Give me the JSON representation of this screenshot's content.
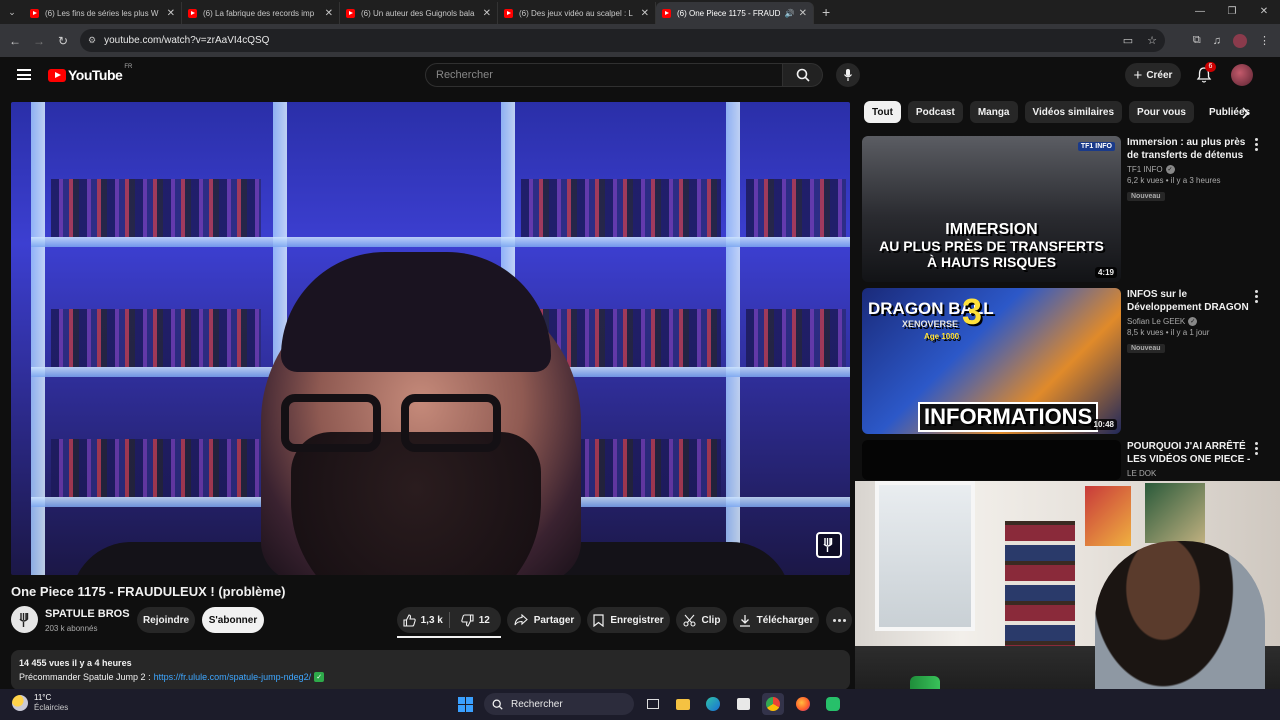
{
  "browser": {
    "tabs": [
      {
        "title": "(6) Les fins de séries les plus W"
      },
      {
        "title": "(6) La fabrique des records imp"
      },
      {
        "title": "(6) Un auteur des Guignols bala"
      },
      {
        "title": "(6) Des jeux vidéo au scalpel : L"
      },
      {
        "title": "(6) One Piece 1175 - FRAUD",
        "active": true
      }
    ],
    "url": "youtube.com/watch?v=zrAaVI4cQSQ"
  },
  "youtube": {
    "logo_text": "YouTube",
    "country_code": "FR",
    "search_placeholder": "Rechercher",
    "create_label": "Créer",
    "notification_count": "6"
  },
  "video": {
    "title": "One Piece 1175 - FRAUDULEUX ! (problème)",
    "channel_name": "SPATULE BROS",
    "channel_subs": "203 k abonnés",
    "join_label": "Rejoindre",
    "subscribe_label": "S'abonner",
    "likes": "1,3 k",
    "dislikes": "12",
    "share_label": "Partager",
    "save_label": "Enregistrer",
    "clip_label": "Clip",
    "download_label": "Télécharger",
    "views_line": "14 455 vues  il y a 4 heures",
    "desc_prefix": "Précommander Spatule Jump 2 : ",
    "desc_link": "https://fr.ulule.com/spatule-jump-ndeg2/"
  },
  "chips": [
    "Tout",
    "Podcast",
    "Manga",
    "Vidéos similaires",
    "Pour vous",
    "Publiées réc"
  ],
  "recommended": [
    {
      "title": "Immersion : au plus près de transferts de détenus à ...",
      "channel": "TF1 INFO",
      "meta": "6,2 k vues • il y a 3 heures",
      "badge": "Nouveau",
      "duration": "4:19",
      "thumb_lines": [
        "IMMERSION",
        "AU PLUS PRÈS DE TRANSFERTS",
        "À HAUTS RISQUES"
      ],
      "thumb_corner": "TF1 INFO"
    },
    {
      "title": "INFOS sur le Développement DRAGON ...",
      "channel": "Sofian Le GEEK",
      "meta": "8,5 k vues • il y a 1 jour",
      "badge": "Nouveau",
      "duration": "10:48",
      "thumb_lines": [
        "DRAGON BALL",
        "3",
        "XENOVERSE",
        "Age 1000",
        "INFORMATIONS"
      ]
    },
    {
      "title": "POURQUOI J'AI ARRÊTÉ LES VIDÉOS ONE PIECE - vidéo...",
      "channel": "LE DOK"
    }
  ],
  "taskbar": {
    "temperature": "11°C",
    "weather": "Éclaircies",
    "search_label": "Rechercher"
  }
}
